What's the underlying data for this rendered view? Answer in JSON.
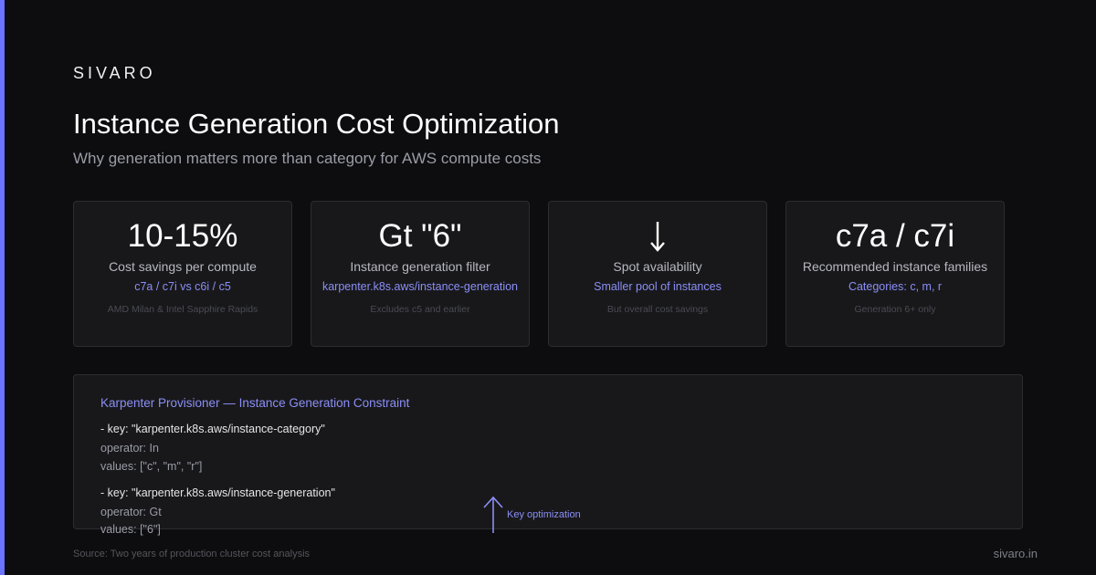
{
  "brand": "SIVARO",
  "title": "Instance Generation Cost Optimization",
  "subtitle": "Why generation matters more than category for AWS compute costs",
  "cards": [
    {
      "metric": "10-15%",
      "label": "Cost savings per compute",
      "detail": "c7a / c7i vs c6i / c5",
      "note": "AMD Milan & Intel Sapphire Rapids"
    },
    {
      "metric": "Gt \"6\"",
      "label": "Instance generation filter",
      "detail": "karpenter.k8s.aws/instance-generation",
      "note": "Excludes c5 and earlier"
    },
    {
      "metric_icon": "arrow-down-icon",
      "label": "Spot availability",
      "detail": "Smaller pool of instances",
      "note": "But overall cost savings"
    },
    {
      "metric": "c7a / c7i",
      "label": "Recommended instance families",
      "detail": "Categories: c, m, r",
      "note": "Generation 6+ only"
    }
  ],
  "code": {
    "title": "Karpenter Provisioner — Instance Generation Constraint",
    "blocks": [
      {
        "key": "- key: \"karpenter.k8s.aws/instance-category\"",
        "operator": "operator: In",
        "values": "values: [\"c\", \"m\", \"r\"]"
      },
      {
        "key": "- key: \"karpenter.k8s.aws/instance-generation\"",
        "operator": "operator: Gt",
        "values": "values: [\"6\"]"
      }
    ]
  },
  "callout": {
    "icon": "arrow-up-icon",
    "text": "Key optimization"
  },
  "footer": {
    "source": "Source: Two years of production cluster cost analysis",
    "site": "sivaro.in"
  },
  "colors": {
    "accent": "#6b74ff",
    "accent_text": "#8b8ff5",
    "background": "#0d0d0f",
    "card": "#18181b"
  }
}
